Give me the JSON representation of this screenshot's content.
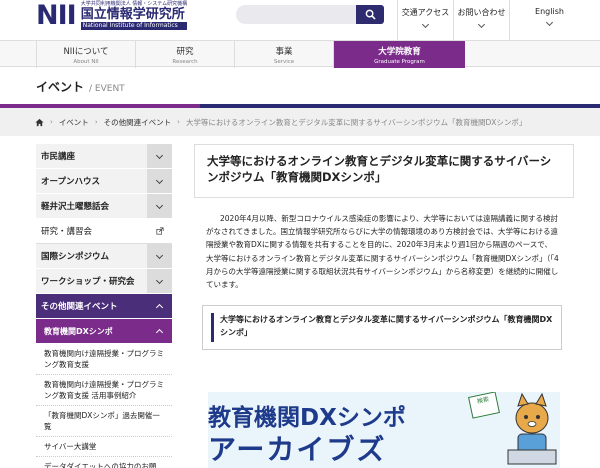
{
  "header": {
    "logo_mark": "NII",
    "logo_small": "大学共同利用機関法人 情報・システム研究機構",
    "logo_main": "国立情報学研究所",
    "logo_en": "National Institute of Informatics",
    "search_placeholder": "",
    "topnav": [
      {
        "label": "交通アクセス"
      },
      {
        "label": "お問い合わせ"
      },
      {
        "label": "English"
      }
    ]
  },
  "mainnav": [
    {
      "jp": "NIIについて",
      "en": "About NII"
    },
    {
      "jp": "研究",
      "en": "Research"
    },
    {
      "jp": "事業",
      "en": "Service"
    },
    {
      "jp": "大学院教育",
      "en": "Graduate Program"
    }
  ],
  "page_title": {
    "jp": "イベント",
    "sep": "/ EVENT"
  },
  "breadcrumb": [
    "トップ",
    "イベント",
    "その他関連イベント",
    "大学等におけるオンライン教育とデジタル変革に関するサイバーシンポジウム「教育機関DXシンポ」"
  ],
  "sidebar": {
    "items": [
      {
        "label": "市民講座"
      },
      {
        "label": "オープンハウス"
      },
      {
        "label": "軽井沢土曜懇話会"
      },
      {
        "label": "研究・講習会"
      },
      {
        "label": "国際シンポジウム"
      },
      {
        "label": "ワークショップ・研究会"
      },
      {
        "label": "その他関連イベント"
      },
      {
        "label": "教育機関DXシンポ"
      }
    ],
    "sub_items": [
      {
        "label": "教育機関向け遠隔授業・プログラミング教育支援"
      },
      {
        "label": "教育機関向け遠隔授業・プログラミング教育支援 活用事例紹介"
      },
      {
        "label": "「教育機関DXシンポ」過去開催一覧"
      },
      {
        "label": "サイバー大講堂"
      },
      {
        "label": "データダイエットへの協力のお願い：遠隔授業を主催される先生方へ"
      }
    ]
  },
  "content": {
    "title": "大学等におけるオンライン教育とデジタル変革に関するサイバーシンポジウム「教育機関DXシンポ」",
    "body": "2020年4月以降、新型コロナウイルス感染症の影響により、大学等においては遠隔講義に関する検討がなされてきました。国立情報学研究所ならびに大学の情報環境のあり方検討会では、大学等における遠隔授業や教育DXに関する情報を共有することを目的に、2020年3月末より週1回から隔週のペースで、大学等におけるオンライン教育とデジタル変革に関するサイバーシンポジウム「教育機関DXシンポ」（「4月からの大学等遠隔授業に関する取組状況共有サイバーシンポジウム」から名称変更）を継続的に開催しています。",
    "callout": "大学等におけるオンライン教育とデジタル変革に関するサイバーシンポジウム「教育機関DXシンポ」",
    "banner_line1": "教育機関DXシンポ",
    "banner_line2": "アーカイブズ",
    "banner_tag": "検索"
  },
  "colors": {
    "navy": "#2a2a72",
    "purple": "#7b2c8b",
    "dark_purple": "#4a2e7a"
  }
}
